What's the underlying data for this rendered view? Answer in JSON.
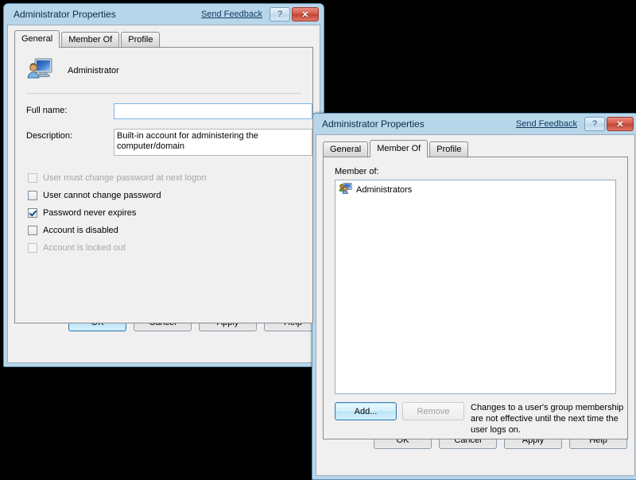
{
  "desktop": {
    "background": "#000000"
  },
  "dialog_general": {
    "title": "Administrator Properties",
    "send_feedback": "Send Feedback",
    "help_button": "?",
    "close_button": "✕",
    "tabs": [
      {
        "label": "General",
        "active": true
      },
      {
        "label": "Member Of",
        "active": false
      },
      {
        "label": "Profile",
        "active": false
      }
    ],
    "user_icon": "user-account-icon",
    "user_name": "Administrator",
    "fields": [
      {
        "label": "Full name:",
        "value": "",
        "focused": true
      },
      {
        "label": "Description:",
        "value": "Built-in account for administering the computer/domain",
        "focused": false
      }
    ],
    "checkboxes": [
      {
        "label": "User must change password at next logon",
        "checked": false,
        "disabled": true
      },
      {
        "label": "User cannot change password",
        "checked": false,
        "disabled": false
      },
      {
        "label": "Password never expires",
        "checked": true,
        "disabled": false
      },
      {
        "label": "Account is disabled",
        "checked": false,
        "disabled": false
      },
      {
        "label": "Account is locked out",
        "checked": false,
        "disabled": true
      }
    ],
    "buttons": [
      {
        "label": "OK",
        "default": true,
        "disabled": false
      },
      {
        "label": "Cancel",
        "default": false,
        "disabled": false
      },
      {
        "label": "Apply",
        "default": false,
        "disabled": false
      },
      {
        "label": "Help",
        "default": false,
        "disabled": false
      }
    ]
  },
  "dialog_memberof": {
    "title": "Administrator Properties",
    "send_feedback": "Send Feedback",
    "help_button": "?",
    "close_button": "✕",
    "tabs": [
      {
        "label": "General",
        "active": false
      },
      {
        "label": "Member Of",
        "active": true
      },
      {
        "label": "Profile",
        "active": false
      }
    ],
    "member_of_label": "Member of:",
    "groups": [
      {
        "name": "Administrators",
        "icon": "group-icon"
      }
    ],
    "add_button": "Add...",
    "remove_button": "Remove",
    "note": "Changes to a user's group membership are not effective until the next time the user logs on.",
    "buttons": [
      {
        "label": "OK",
        "default": false,
        "disabled": false
      },
      {
        "label": "Cancel",
        "default": false,
        "disabled": false
      },
      {
        "label": "Apply",
        "default": false,
        "disabled": false
      },
      {
        "label": "Help",
        "default": false,
        "disabled": false
      }
    ]
  },
  "colors": {
    "frame": "#b8d6ea",
    "client": "#f0f0f0",
    "close_red": "#c04433",
    "focus_blue": "#3c7fb1",
    "link": "#123c63"
  }
}
